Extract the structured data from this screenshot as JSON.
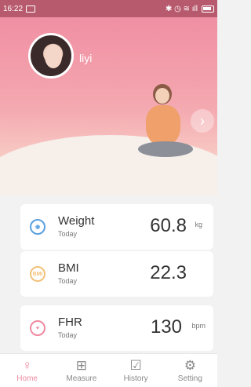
{
  "status": {
    "time": "16:22",
    "icons": "✱ ◷ ≋ ıll"
  },
  "profile": {
    "username": "liyi"
  },
  "colors": {
    "accent": "#ef8aa0",
    "weight_icon": "#5aa0e0",
    "bmi_icon": "#f2c27a",
    "fhr_icon": "#ef8aa0"
  },
  "metrics": [
    {
      "label": "Weight",
      "sub": "Today",
      "value": "60.8",
      "unit": "kg",
      "icon": "scale-icon"
    },
    {
      "label": "BMI",
      "sub": "Today",
      "value": "22.3",
      "unit": "",
      "icon": "bmi-icon",
      "icon_text": "BMI"
    },
    {
      "label": "FHR",
      "sub": "Today",
      "value": "130",
      "unit": "bpm",
      "icon": "heart-icon"
    }
  ],
  "tabs": [
    {
      "label": "Home",
      "icon": "person-icon",
      "active": true
    },
    {
      "label": "Measure",
      "icon": "plus-clipboard-icon",
      "active": false
    },
    {
      "label": "History",
      "icon": "chart-icon",
      "active": false
    },
    {
      "label": "Setting",
      "icon": "gear-icon",
      "active": false
    }
  ]
}
